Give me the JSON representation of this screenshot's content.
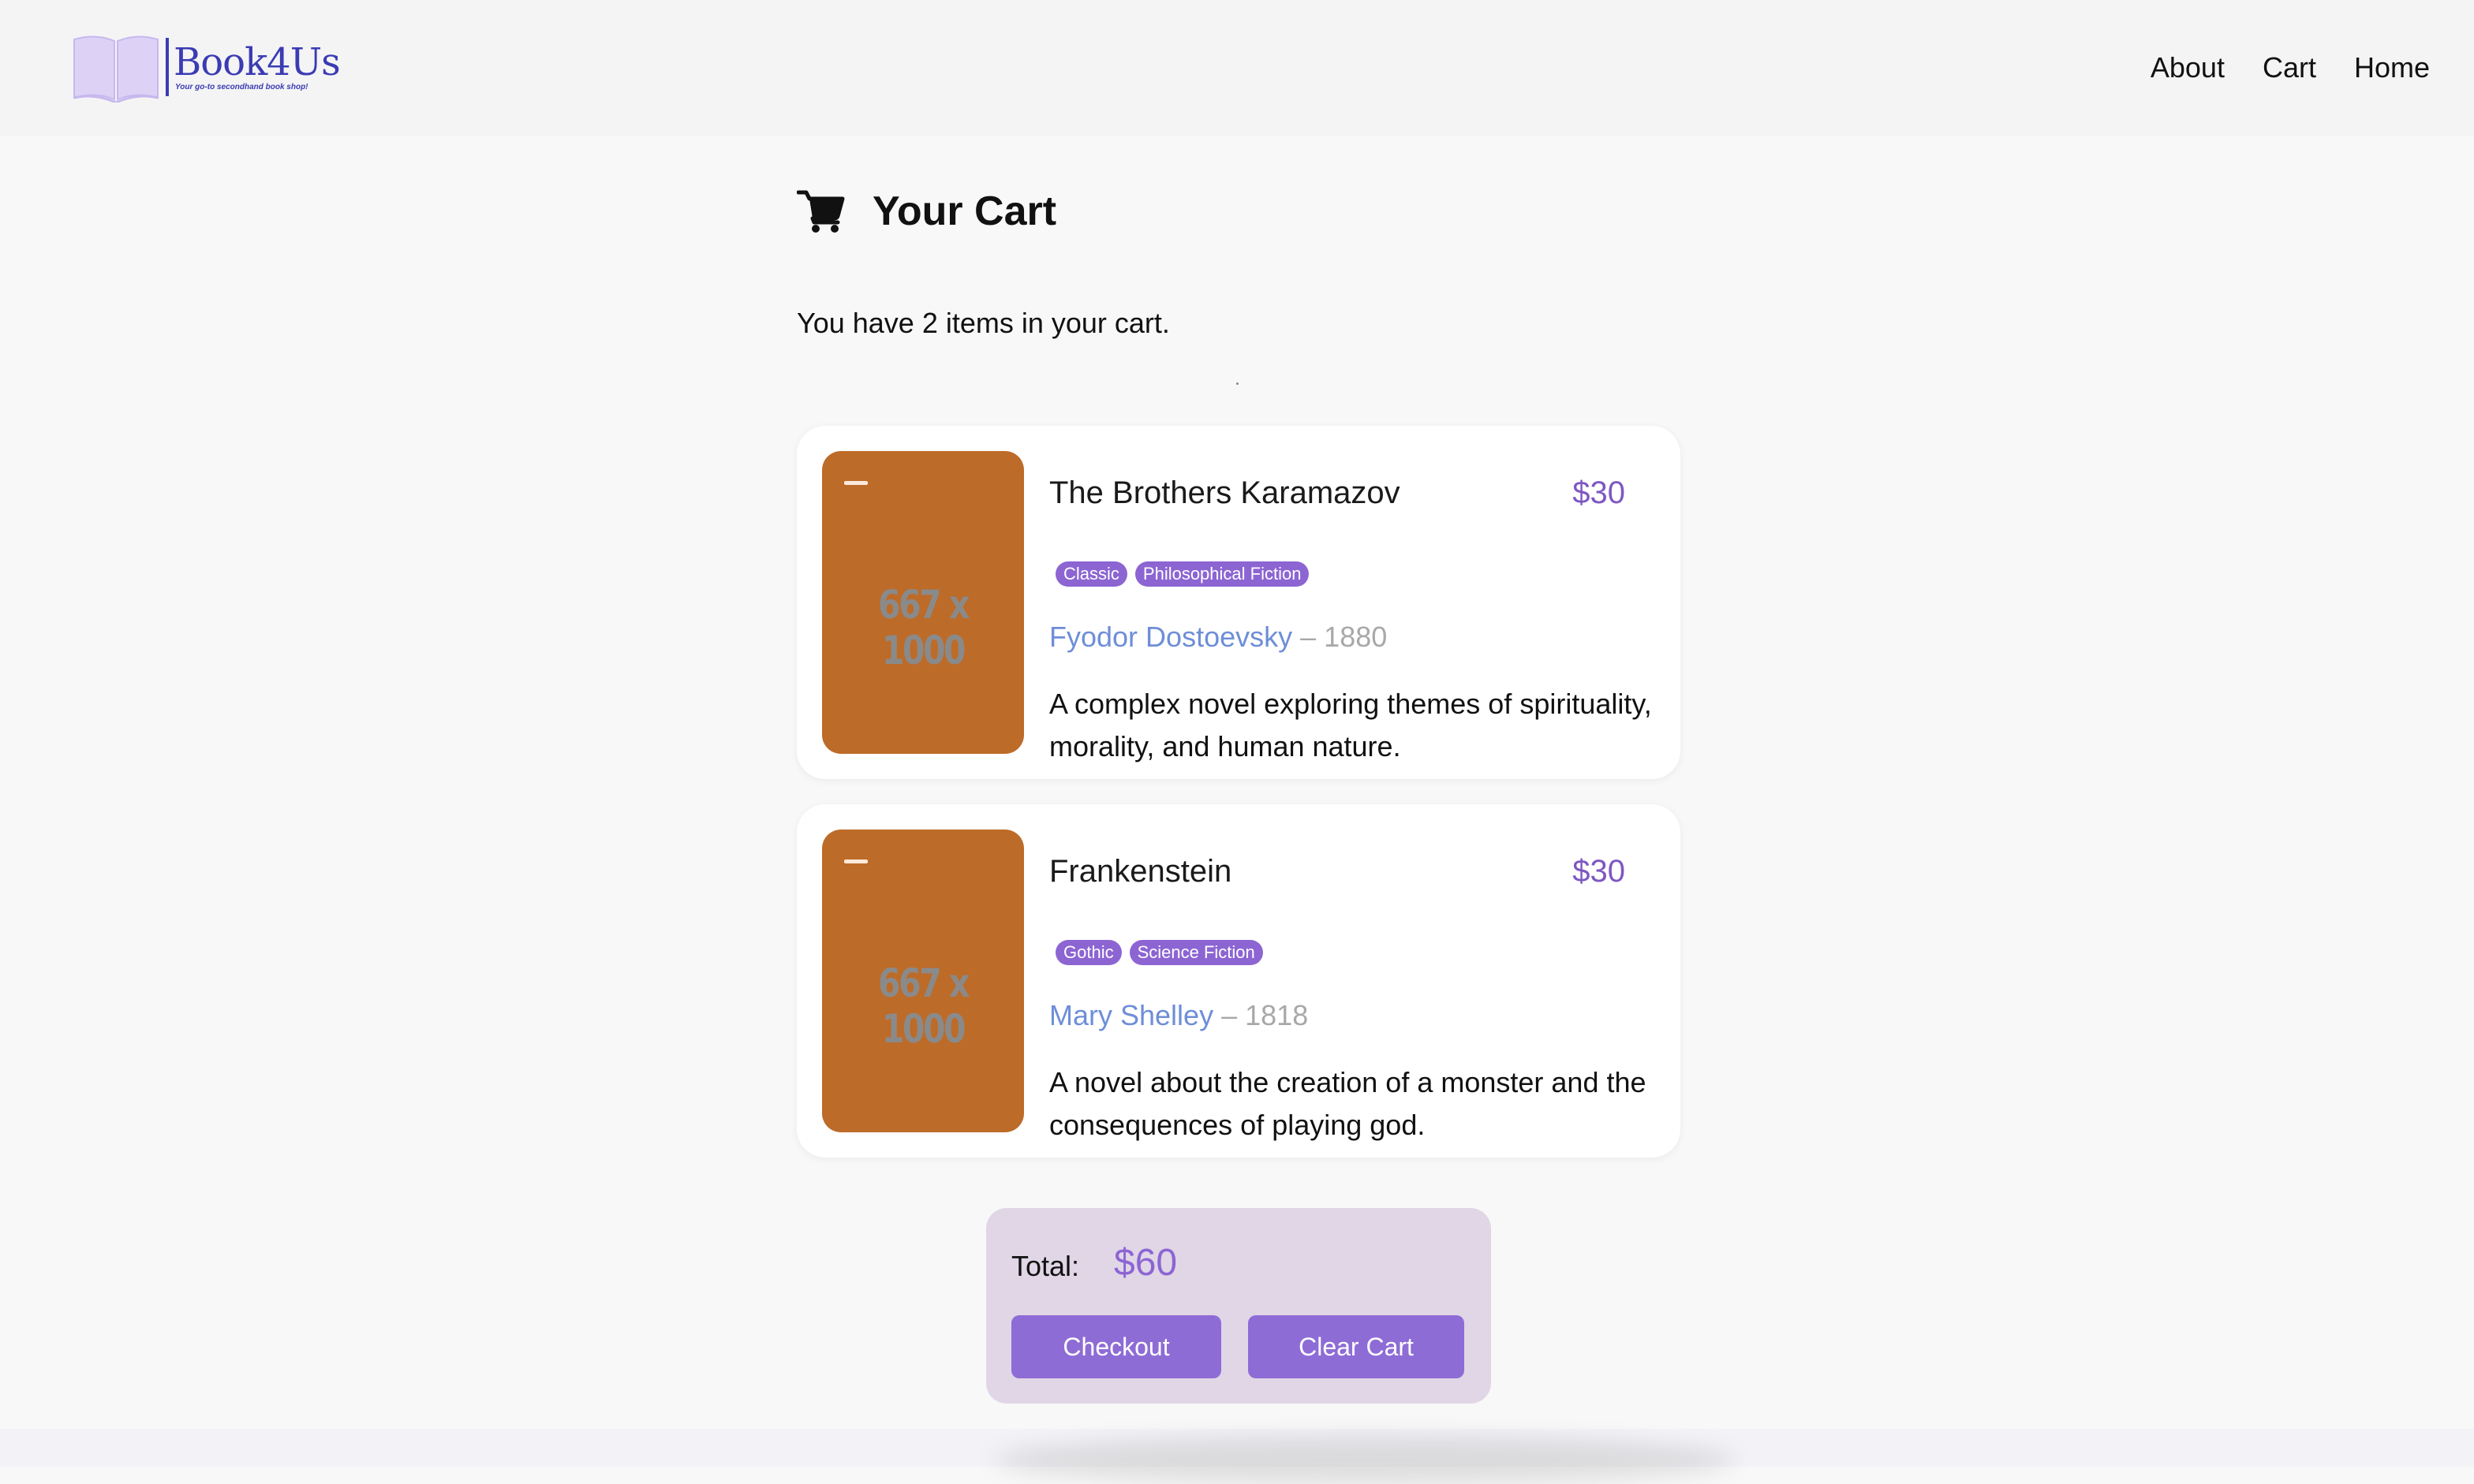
{
  "brand": {
    "name": "Book4Us",
    "tagline": "Your go-to secondhand book shop!",
    "colors": {
      "logo": "#3b3bb3",
      "accent": "#8c65d3",
      "author_link": "#6e8ed8"
    }
  },
  "nav": {
    "items": [
      {
        "label": "About"
      },
      {
        "label": "Cart"
      },
      {
        "label": "Home"
      }
    ]
  },
  "page": {
    "heading_icon": "shopping-cart-icon",
    "heading": "Your Cart",
    "count_text": "You have 2 items in your cart."
  },
  "cart": {
    "items": [
      {
        "title": "The Brothers Karamazov",
        "price": "$30",
        "tags": [
          "Classic",
          "Philosophical Fiction"
        ],
        "author": "Fyodor Dostoevsky",
        "separator": "–",
        "year": "1880",
        "description": "A complex novel exploring themes of spirituality, morality, and human nature.",
        "cover_placeholder": "667 x 1000",
        "cover_color": "#bd6b28"
      },
      {
        "title": "Frankenstein",
        "price": "$30",
        "tags": [
          "Gothic",
          "Science Fiction"
        ],
        "author": "Mary Shelley",
        "separator": "–",
        "year": "1818",
        "description": "A novel about the creation of a monster and the consequences of playing god.",
        "cover_placeholder": "667 x 1000",
        "cover_color": "#bd6b28"
      }
    ]
  },
  "summary": {
    "total_label": "Total:",
    "total_value": "$60",
    "checkout_label": "Checkout",
    "clear_label": "Clear Cart"
  }
}
